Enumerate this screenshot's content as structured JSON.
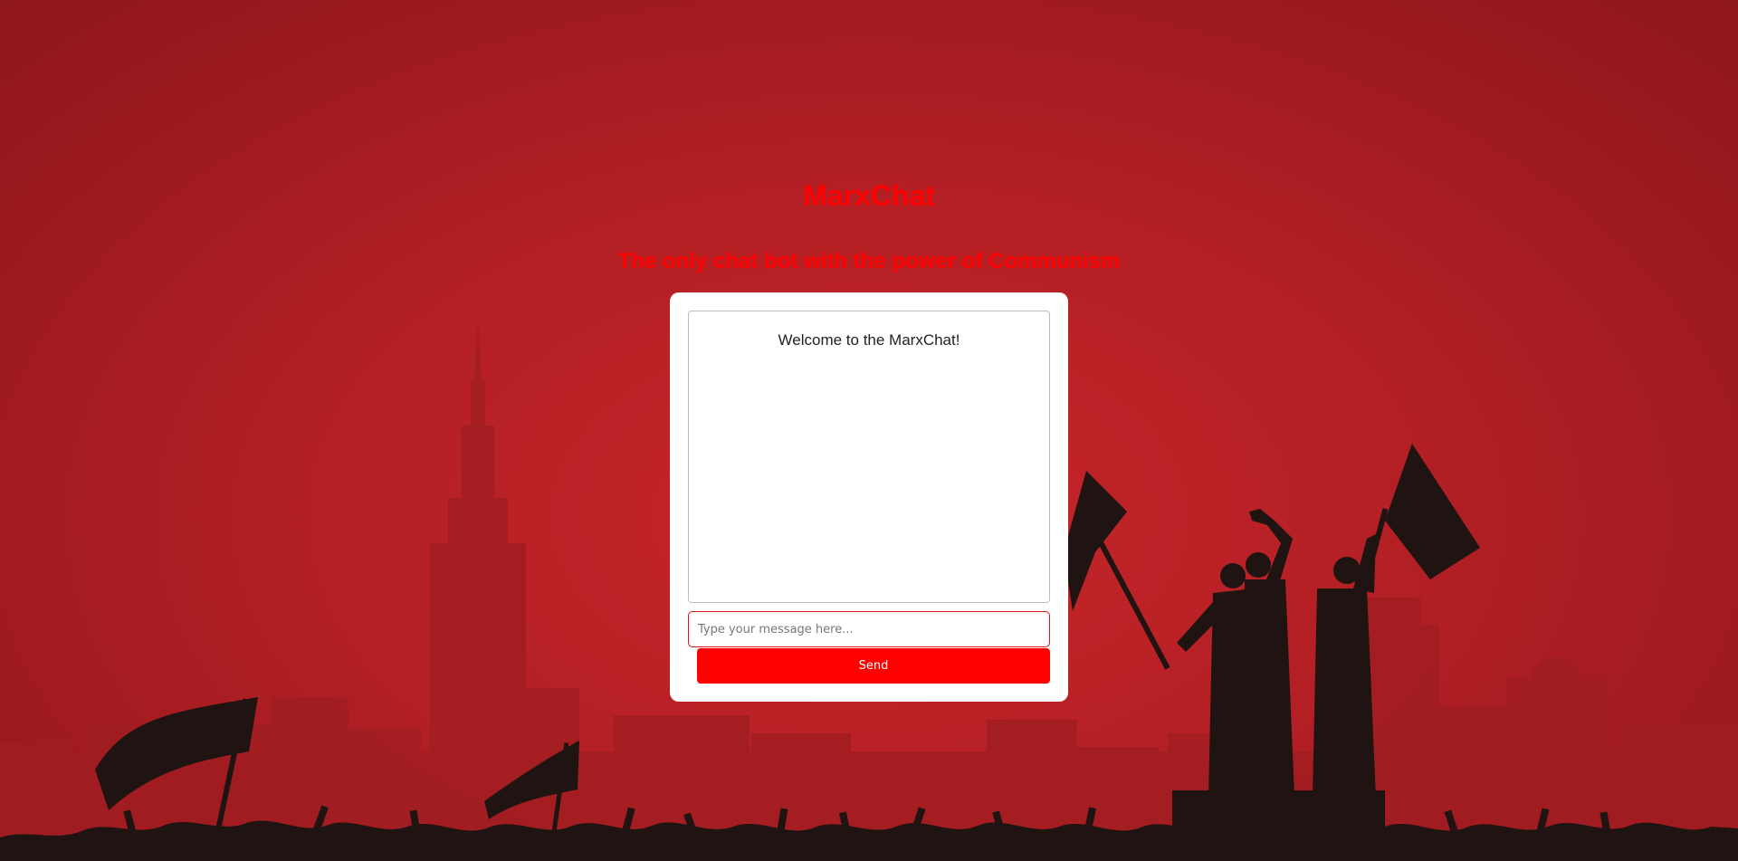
{
  "header": {
    "title": "MarxChat",
    "subtitle": "The only chat bot with the power of Communism"
  },
  "chat": {
    "welcome_message": "Welcome to the MarxChat!",
    "input_placeholder": "Type your message here...",
    "input_value": "",
    "send_label": "Send"
  },
  "colors": {
    "accent": "#ff0000",
    "background": "#b21f24",
    "silhouette": "#1f1412",
    "card": "#ffffff"
  },
  "background_art": {
    "icon": "protest-crowd-city-skyline-silhouette"
  }
}
